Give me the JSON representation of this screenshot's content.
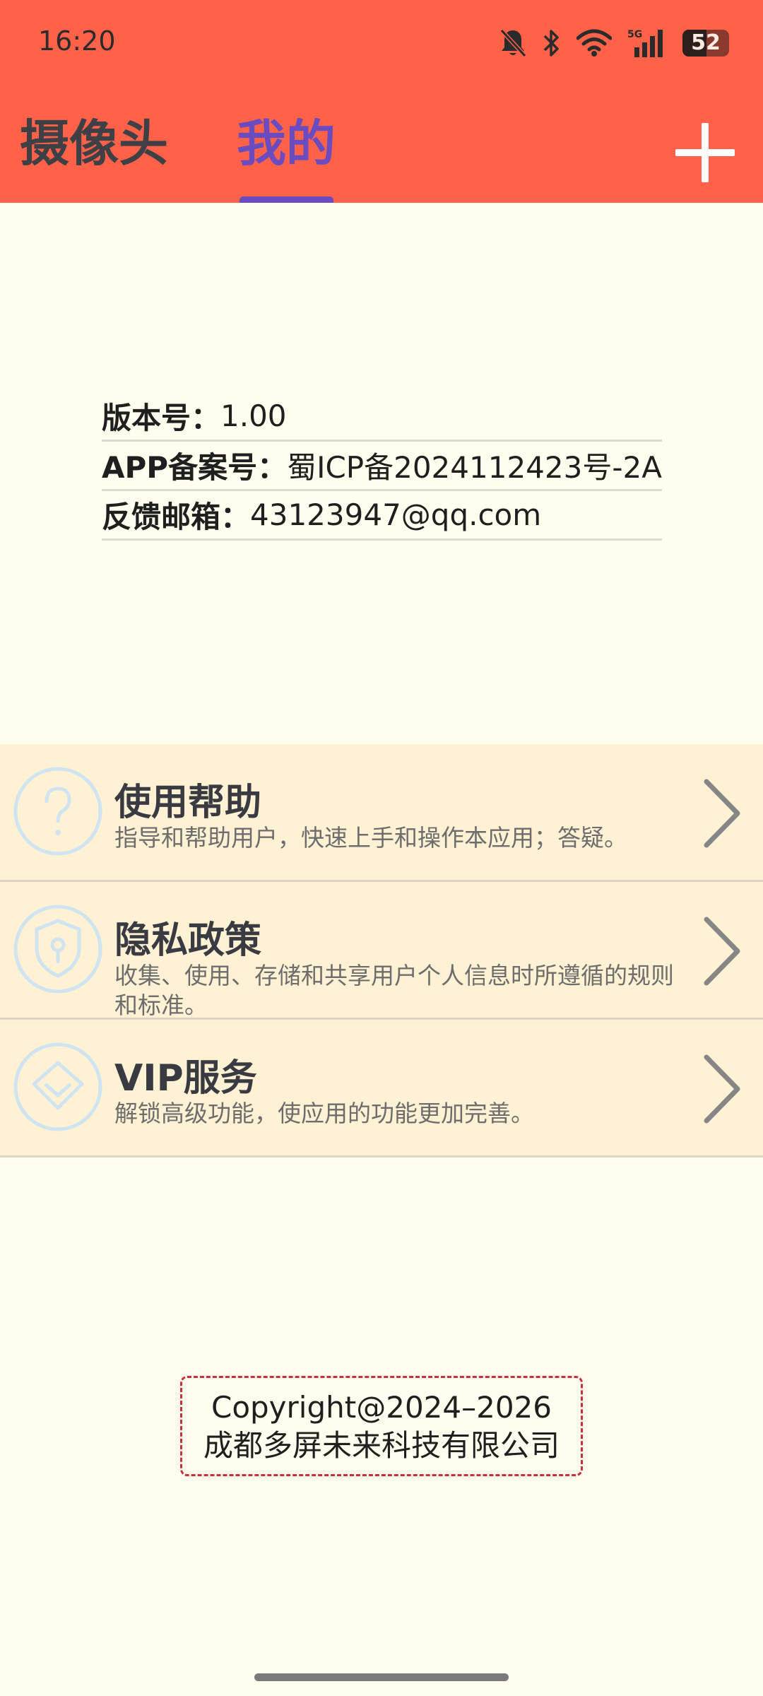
{
  "status_bar": {
    "time": "16:20",
    "battery": "52",
    "battery_level": 0.52,
    "network_label": "5G",
    "icons": [
      "bell-off-icon",
      "bluetooth-icon",
      "wifi-icon",
      "signal-icon",
      "battery-icon"
    ]
  },
  "header": {
    "tabs": [
      {
        "label": "摄像头",
        "active": false
      },
      {
        "label": "我的",
        "active": true
      }
    ],
    "add_icon": "plus-icon"
  },
  "info": {
    "version": {
      "label": "版本号：",
      "value": "1.00"
    },
    "icp": {
      "label": "APP备案号：",
      "value": "蜀ICP备2024112423号-2A"
    },
    "email": {
      "label": "反馈邮箱：",
      "value": "43123947@qq.com"
    }
  },
  "menu": {
    "items": [
      {
        "title": "使用帮助",
        "desc": "指导和帮助用户，快速上手和操作本应用；答疑。",
        "icon": "question-icon"
      },
      {
        "title": "隐私政策",
        "desc": "收集、使用、存储和共享用户个人信息时所遵循的规则和标准。",
        "icon": "shield-icon"
      },
      {
        "title": "VIP服务",
        "desc": "解锁高级功能，使应用的功能更加完善。",
        "icon": "diamond-icon"
      }
    ]
  },
  "footer": {
    "copyright_line1": "Copyright@2024–2026",
    "copyright_line2": "成都多屏未来科技有限公司"
  },
  "colors": {
    "header_bg": "#FF6249",
    "active_tab": "#6A4CC0",
    "page_bg": "#FFFDEE",
    "menu_bg": "#FFF2D4",
    "copyright_border": "#C8303A"
  }
}
